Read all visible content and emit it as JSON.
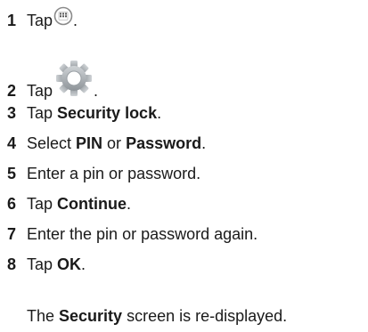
{
  "steps": [
    {
      "num": "1",
      "parts": [
        {
          "t": "Tap "
        },
        {
          "icon": "apps-grid-icon"
        },
        {
          "t": "."
        }
      ]
    },
    {
      "num": "2",
      "parts": [
        {
          "t": "Tap "
        },
        {
          "icon": "settings-gear-icon"
        },
        {
          "t": "."
        }
      ]
    },
    {
      "num": "3",
      "parts": [
        {
          "t": "Tap "
        },
        {
          "t": "Security lock",
          "b": true
        },
        {
          "t": "."
        }
      ]
    },
    {
      "num": "4",
      "parts": [
        {
          "t": "Select "
        },
        {
          "t": "PIN",
          "b": true
        },
        {
          "t": " or "
        },
        {
          "t": "Password",
          "b": true
        },
        {
          "t": "."
        }
      ]
    },
    {
      "num": "5",
      "parts": [
        {
          "t": "Enter a pin or password."
        }
      ]
    },
    {
      "num": "6",
      "parts": [
        {
          "t": "Tap "
        },
        {
          "t": "Continue",
          "b": true
        },
        {
          "t": "."
        }
      ]
    },
    {
      "num": "7",
      "parts": [
        {
          "t": "Enter the pin or password again."
        }
      ]
    },
    {
      "num": "8",
      "parts": [
        {
          "t": "Tap "
        },
        {
          "t": "OK",
          "b": true
        },
        {
          "t": "."
        }
      ]
    }
  ],
  "note": {
    "parts": [
      {
        "t": "The "
      },
      {
        "t": "Security",
        "b": true
      },
      {
        "t": " screen is re-displayed."
      }
    ]
  }
}
